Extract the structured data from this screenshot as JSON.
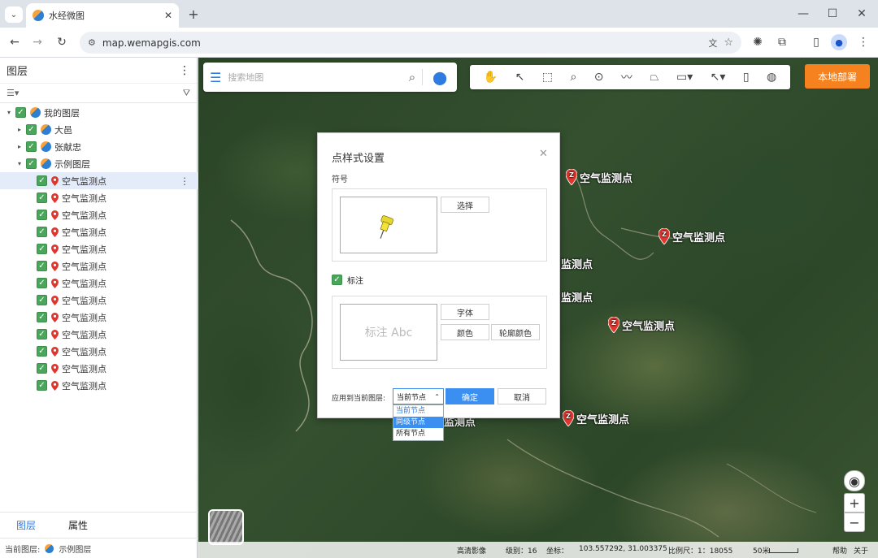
{
  "browser": {
    "tab_title": "水经微图",
    "url": "map.wemapgis.com"
  },
  "panel": {
    "title": "图层",
    "tabs": [
      "图层",
      "属性"
    ],
    "footer_label": "当前图层:",
    "footer_layer": "示例图层",
    "tree": [
      {
        "label": "我的图层",
        "level": 0,
        "type": "layer",
        "caret": "▾"
      },
      {
        "label": "大邑",
        "level": 1,
        "type": "layer",
        "caret": "▸"
      },
      {
        "label": "张献忠",
        "level": 1,
        "type": "layer",
        "caret": "▸"
      },
      {
        "label": "示例图层",
        "level": 1,
        "type": "layer",
        "caret": "▾"
      },
      {
        "label": "空气监测点",
        "level": 2,
        "type": "point",
        "selected": true
      },
      {
        "label": "空气监测点",
        "level": 2,
        "type": "point"
      },
      {
        "label": "空气监测点",
        "level": 2,
        "type": "point"
      },
      {
        "label": "空气监测点",
        "level": 2,
        "type": "point"
      },
      {
        "label": "空气监测点",
        "level": 2,
        "type": "point"
      },
      {
        "label": "空气监测点",
        "level": 2,
        "type": "point"
      },
      {
        "label": "空气监测点",
        "level": 2,
        "type": "point"
      },
      {
        "label": "空气监测点",
        "level": 2,
        "type": "point"
      },
      {
        "label": "空气监测点",
        "level": 2,
        "type": "point"
      },
      {
        "label": "空气监测点",
        "level": 2,
        "type": "point"
      },
      {
        "label": "空气监测点",
        "level": 2,
        "type": "point"
      },
      {
        "label": "空气监测点",
        "level": 2,
        "type": "point"
      },
      {
        "label": "空气监测点",
        "level": 2,
        "type": "point"
      }
    ]
  },
  "map": {
    "search_placeholder": "搜索地图",
    "local_deploy": "本地部署",
    "marker_label": "空气监测点",
    "partial_labels": [
      "监测点",
      "监测点",
      "监测点"
    ],
    "status": {
      "imagery": "高清影像",
      "level": "级别：16",
      "coords_label": "坐标：",
      "coords": "103.557292, 31.003375",
      "scale": "比例尺：1：18055",
      "scale_bar": "50米",
      "help": "帮助",
      "about": "关于"
    }
  },
  "dialog": {
    "title": "点样式设置",
    "symbol_section": "符号",
    "select_btn": "选择",
    "label_check": "标注",
    "preview_text": "标注 Abc",
    "font_btn": "字体",
    "color_btn": "颜色",
    "outline_btn": "轮廓颜色",
    "apply_label": "应用到当前图层:",
    "apply_value": "当前节点",
    "ok": "确定",
    "cancel": "取消",
    "options": [
      "当前节点",
      "同级节点",
      "所有节点"
    ],
    "highlighted_option": 1
  },
  "colors": {
    "accent": "#3b8ff0",
    "orange": "#f5821f",
    "check": "#4aa65a"
  }
}
